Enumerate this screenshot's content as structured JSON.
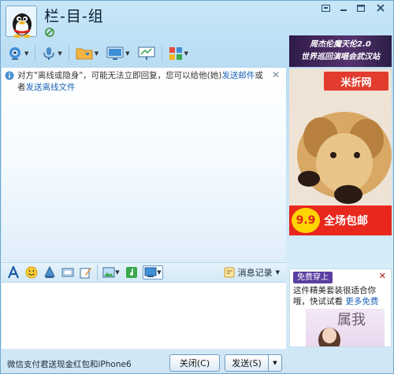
{
  "window": {
    "title": "栏-目-组",
    "controls": [
      "restore-down-icon",
      "minimize-icon",
      "maximize-icon",
      "close-icon"
    ]
  },
  "toolbar": {
    "buttons": [
      {
        "name": "video-call",
        "icon": "webcam-icon"
      },
      {
        "name": "voice-call",
        "icon": "microphone-icon"
      },
      {
        "name": "send-file",
        "icon": "folder-icon"
      },
      {
        "name": "remote-desktop",
        "icon": "monitor-icon"
      },
      {
        "name": "share-screen",
        "icon": "presentation-icon"
      },
      {
        "name": "apps",
        "icon": "apps-grid-icon"
      }
    ]
  },
  "notice": {
    "text_before": "对方\"离线或隐身\"，可能无法立即回复，您可以给他(她)",
    "link1": "发送邮件",
    "text_middle": "或者",
    "link2": "发送离线文件"
  },
  "format_toolbar": {
    "buttons": [
      "font-icon",
      "emoji-icon",
      "shake-icon",
      "image-frame-icon",
      "edit-icon",
      "picture-icon",
      "music-icon",
      "screenshot-icon"
    ],
    "history_label": "消息记录"
  },
  "bottom": {
    "promo_text": "微信支付君送现金红包和iPhone6",
    "close_label": "关闭(C)",
    "send_label": "发送(S)"
  },
  "ads": {
    "top_banner": {
      "line1": "周杰伦魔天伦2.0",
      "line2": "世界巡回演唱会武汉站"
    },
    "main": {
      "brand": "米折网",
      "price": "9.9",
      "slogan": "全场包邮"
    },
    "side": {
      "tag": "免费穿上",
      "text": "这件精美套装很适合你哦，快试试看",
      "link": "更多免费",
      "calligraphy": "属我"
    }
  }
}
